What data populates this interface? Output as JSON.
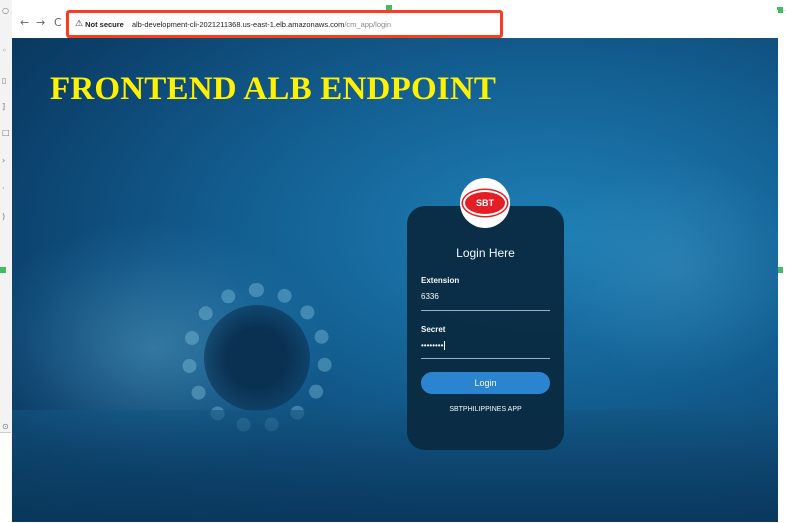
{
  "browser": {
    "nav_back": "←",
    "nav_forward": "→",
    "nav_reload": "C",
    "warning_icon": "⚠",
    "security_label": "Not secure",
    "url_host": "alb-development-cli-2021211368.us-east-1.elb.amazonaws.com",
    "url_path": "/cm_app/login"
  },
  "page": {
    "headline": "FRONTEND ALB ENDPOINT",
    "colors": {
      "headline": "#fff200",
      "highlight_box": "#ff3b1f",
      "login_button": "#2c86d1",
      "logo_red": "#e31e24"
    }
  },
  "login": {
    "logo_text": "SBT",
    "title": "Login Here",
    "extension_label": "Extension",
    "extension_value": "6336",
    "secret_label": "Secret",
    "secret_value": "••••••••",
    "button_label": "Login",
    "app_name": "SBTPHILIPPINES APP"
  }
}
